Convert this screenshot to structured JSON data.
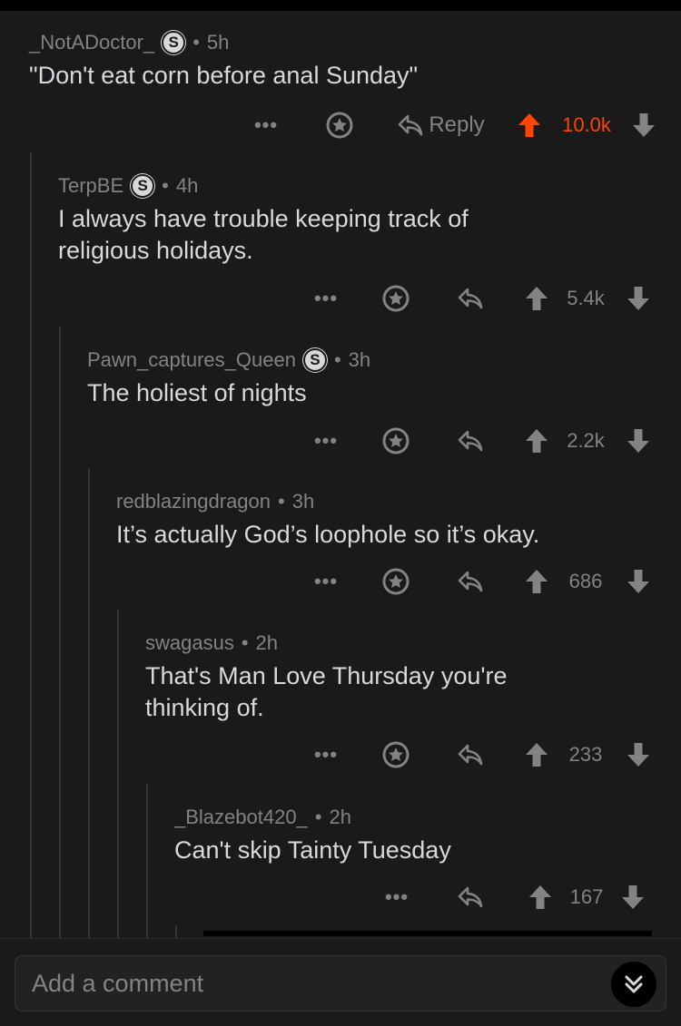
{
  "comments": [
    {
      "user": "_NotADoctor_",
      "badge": "S",
      "age": "5h",
      "text": "\"Don't eat corn before anal Sunday\"",
      "score": "10.0k",
      "upvoted": true,
      "reply_label": "Reply"
    },
    {
      "user": "TerpBE",
      "badge": "S",
      "age": "4h",
      "line1": "I always have trouble keeping track of",
      "line2": "religious holidays.",
      "score": "5.4k"
    },
    {
      "user": "Pawn_captures_Queen",
      "badge": "S",
      "age": "3h",
      "text": "The holiest of nights",
      "score": "2.2k"
    },
    {
      "user": "redblazingdragon",
      "age": "3h",
      "text": "It’s actually God’s loophole so it’s okay.",
      "score": "686"
    },
    {
      "user": "swagasus",
      "age": "2h",
      "line1": "That's Man Love Thursday you're",
      "line2": "thinking of.",
      "score": "233"
    },
    {
      "user": "_Blazebot420_",
      "age": "2h",
      "text": "Can't skip Tainty Tuesday",
      "score": "167"
    }
  ],
  "common": {
    "more": "•••",
    "dot": "•"
  },
  "composer": {
    "placeholder": "Add a comment"
  },
  "colors": {
    "upvote_active": "#ff4500",
    "background": "#1a1a1b",
    "muted": "#818384",
    "text": "#d7dadc"
  },
  "icons": [
    "more-icon",
    "award-icon",
    "reply-icon",
    "upvote-icon",
    "downvote-icon",
    "jump-down-icon"
  ]
}
